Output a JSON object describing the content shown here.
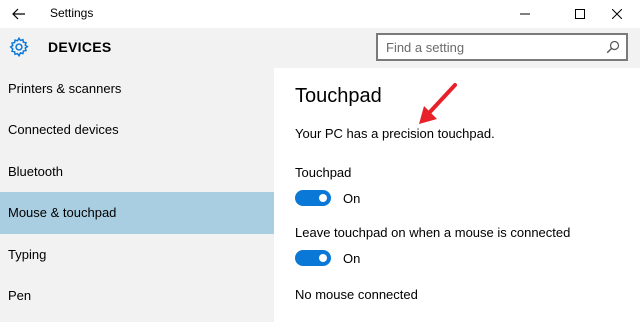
{
  "window": {
    "title": "Settings",
    "back_icon": "arrow-left-icon",
    "minimize_icon": "minimize-icon",
    "maximize_icon": "maximize-icon",
    "close_icon": "close-icon"
  },
  "header": {
    "icon": "gear-icon",
    "title": "DEVICES",
    "search": {
      "placeholder": "Find a setting",
      "value": "",
      "icon": "search-icon"
    }
  },
  "sidebar": {
    "items": [
      {
        "label": "Printers & scanners",
        "selected": false
      },
      {
        "label": "Connected devices",
        "selected": false
      },
      {
        "label": "Bluetooth",
        "selected": false
      },
      {
        "label": "Mouse & touchpad",
        "selected": true
      },
      {
        "label": "Typing",
        "selected": false
      },
      {
        "label": "Pen",
        "selected": false
      }
    ]
  },
  "main": {
    "title": "Touchpad",
    "description": "Your PC has a precision touchpad.",
    "settings": [
      {
        "label": "Touchpad",
        "state": "On",
        "on": true
      },
      {
        "label": "Leave touchpad on when a mouse is connected",
        "state": "On",
        "on": true
      }
    ],
    "status": "No mouse connected"
  },
  "annotation": {
    "icon": "red-arrow-icon",
    "color": "#e8202a"
  },
  "colors": {
    "accent": "#0a78d7",
    "selected": "#a9cee2",
    "pane": "#f2f2f2"
  }
}
